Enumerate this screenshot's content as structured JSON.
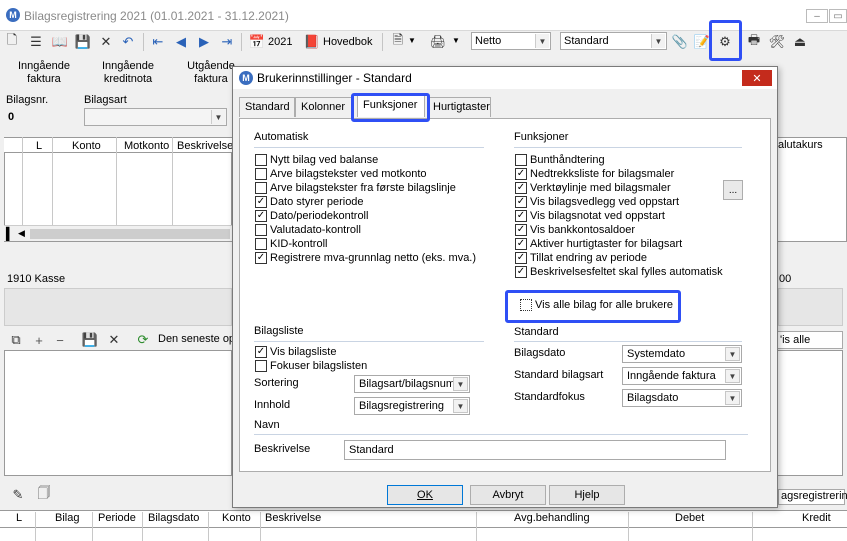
{
  "window": {
    "title": "Bilagsregistrering 2021 (01.01.2021 - 31.12.2021)",
    "app_icon_letter": "M"
  },
  "toolbar": {
    "year_label": "2021",
    "hovedbok_label": "Hovedbok",
    "netto_value": "Netto",
    "standard_value": "Standard"
  },
  "menu_tabs": [
    {
      "line1": "Inngående",
      "line2": "faktura"
    },
    {
      "line1": "Inngående",
      "line2": "kreditnota"
    },
    {
      "line1": "Utgående",
      "line2": "faktura"
    }
  ],
  "fields": {
    "bilagsnr_label": "Bilagsnr.",
    "bilagsnr_value": "0",
    "bilagsart_label": "Bilagsart"
  },
  "grid_top": {
    "columns": [
      "L",
      "Konto",
      "Motkonto",
      "Beskrivelse"
    ],
    "right_column": "alutakurs"
  },
  "status": {
    "account_label": "1910 Kasse",
    "right_value": "00"
  },
  "lower_toolbar": {
    "text": "Den seneste op",
    "right_value": "'is alle"
  },
  "bottom_toolbar": {
    "right_text": "agsregistrering"
  },
  "grid_bottom": {
    "columns": [
      "L",
      "Bilag",
      "Periode",
      "Bilagsdato",
      "Konto",
      "Beskrivelse",
      "Avg.behandling",
      "Debet",
      "Kredit"
    ]
  },
  "dialog": {
    "title": "Brukerinnstillinger - Standard",
    "close_label": "✕",
    "tabs": [
      "Standard",
      "Kolonner",
      "Funksjoner",
      "Hurtigtaster"
    ],
    "active_tab": "Funksjoner",
    "automatisk": {
      "heading": "Automatisk",
      "items": [
        {
          "label": "Nytt bilag ved balanse",
          "checked": false
        },
        {
          "label": "Arve bilagstekster ved motkonto",
          "checked": false
        },
        {
          "label": "Arve bilagstekster fra første bilagslinje",
          "checked": false
        },
        {
          "label": "Dato styrer periode",
          "checked": true
        },
        {
          "label": "Dato/periodekontroll",
          "checked": true
        },
        {
          "label": "Valutadato-kontroll",
          "checked": false
        },
        {
          "label": "KID-kontroll",
          "checked": false
        },
        {
          "label": "Registrere mva-grunnlag netto (eks. mva.)",
          "checked": true
        }
      ]
    },
    "funksjoner": {
      "heading": "Funksjoner",
      "items": [
        {
          "label": "Bunthåndtering",
          "checked": false
        },
        {
          "label": "Nedtrekksliste for bilagsmaler",
          "checked": true
        },
        {
          "label": "Verktøylinje med bilagsmaler",
          "checked": true
        },
        {
          "label": "Vis bilagsvedlegg ved oppstart",
          "checked": true
        },
        {
          "label": "Vis bilagsnotat ved oppstart",
          "checked": true
        },
        {
          "label": "Vis bankkontosaldoer",
          "checked": true
        },
        {
          "label": "Aktiver hurtigtaster for bilagsart",
          "checked": true
        },
        {
          "label": "Tillat endring av periode",
          "checked": true
        },
        {
          "label": "Beskrivelsesfeltet skal fylles automatisk",
          "checked": true
        }
      ],
      "ellipsis": "...",
      "vis_alle": {
        "label": "Vis alle bilag for alle brukere",
        "checked": false
      }
    },
    "bilagsliste": {
      "heading": "Bilagsliste",
      "vis_bilagsliste": {
        "label": "Vis bilagsliste",
        "checked": true
      },
      "fokuser": {
        "label": "Fokuser bilagslisten",
        "checked": false
      },
      "sortering_label": "Sortering",
      "sortering_value": "Bilagsart/bilagsnumr",
      "innhold_label": "Innhold",
      "innhold_value": "Bilagsregistrering"
    },
    "standard": {
      "heading": "Standard",
      "bilagsdato_label": "Bilagsdato",
      "bilagsdato_value": "Systemdato",
      "standard_bilagsart_label": "Standard bilagsart",
      "standard_bilagsart_value": "Inngående faktura",
      "standardfokus_label": "Standardfokus",
      "standardfokus_value": "Bilagsdato"
    },
    "navn": {
      "heading": "Navn",
      "beskrivelse_label": "Beskrivelse",
      "beskrivelse_value": "Standard"
    },
    "buttons": {
      "ok": "OK",
      "avbryt": "Avbryt",
      "hjelp": "Hjelp"
    }
  }
}
